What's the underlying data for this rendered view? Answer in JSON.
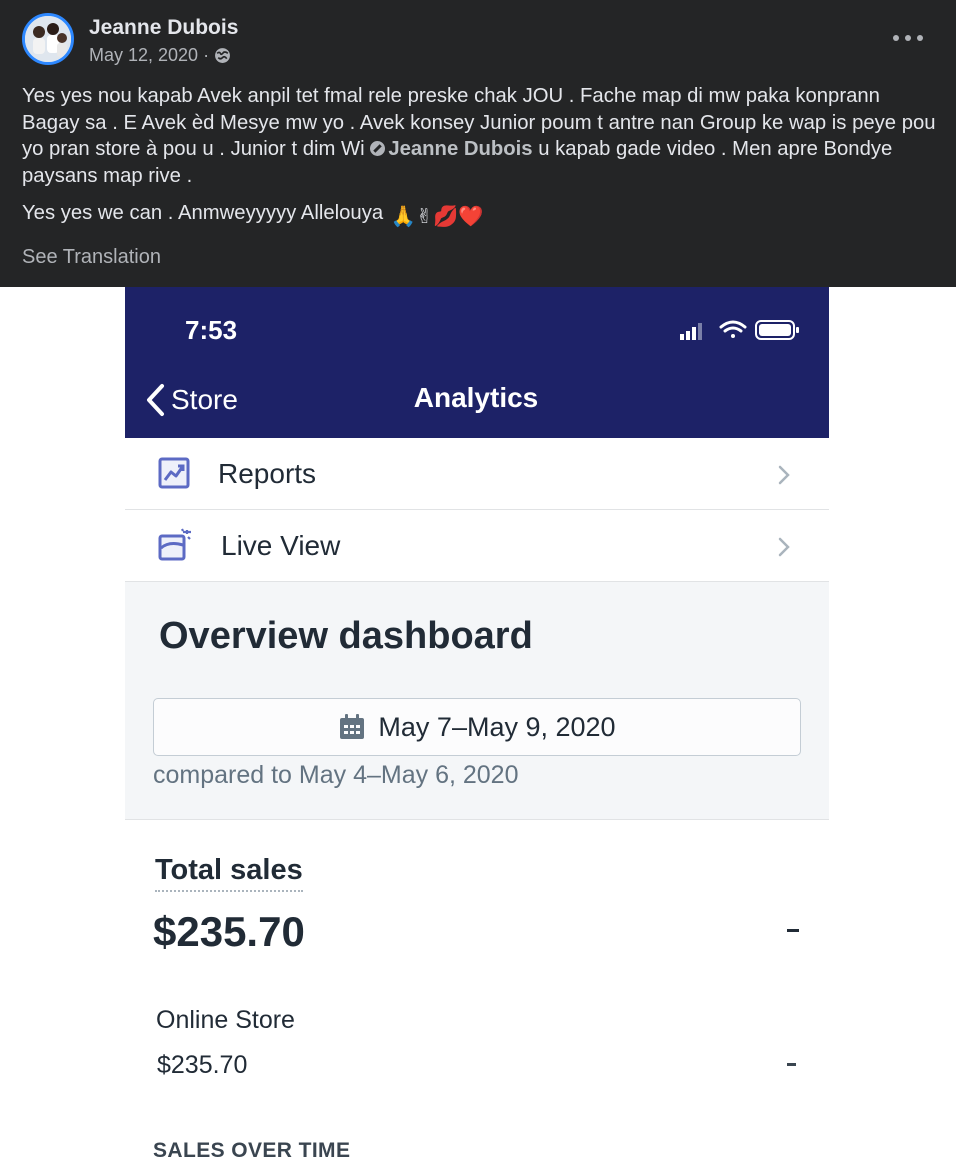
{
  "post": {
    "author": "Jeanne Dubois",
    "date": "May 12, 2020",
    "separator": "·",
    "audience_icon": "globe-icon",
    "text_line1_part1": "Yes yes nou kapab Avek anpil tet fmal rele preske chak JOU . Fache map di mw paka konprann Bagay sa . E Avek èd Mesye mw yo .  Avek konsey Junior poum t antre nan Group ke wap is peye pou yo pran store à pou u . Junior t dim Wi ",
    "mention": "Jeanne Dubois",
    "text_line1_part2": " u kapab gade video . Men apre Bondye paysans map rive .",
    "text_line2": "Yes yes we can . Anmweyyyyy Allelouya ",
    "emojis": "🙏✌💋❤️",
    "see_translation": "See Translation"
  },
  "phone": {
    "status": {
      "time": "7:53",
      "icons": [
        "signal-icon",
        "wifi-icon",
        "battery-icon"
      ]
    },
    "nav": {
      "back_label": "Store",
      "title": "Analytics"
    },
    "menu": [
      {
        "label": "Reports",
        "icon": "reports-chart-icon"
      },
      {
        "label": "Live View",
        "icon": "live-view-icon"
      }
    ],
    "overview": {
      "title": "Overview dashboard",
      "date_range": "May 7–May 9, 2020",
      "compared": "compared to May 4–May 6, 2020"
    },
    "total_sales": {
      "label": "Total sales",
      "value": "$235.70",
      "change": "-",
      "channel_label": "Online Store",
      "channel_value": "$235.70",
      "channel_change": "-"
    },
    "sales_over_time_label": "SALES OVER TIME"
  },
  "colors": {
    "post_bg": "#242526",
    "nav_bg": "#1d2267",
    "accent_ring": "#2d88ff",
    "icon_blue": "#5c6ac4"
  }
}
